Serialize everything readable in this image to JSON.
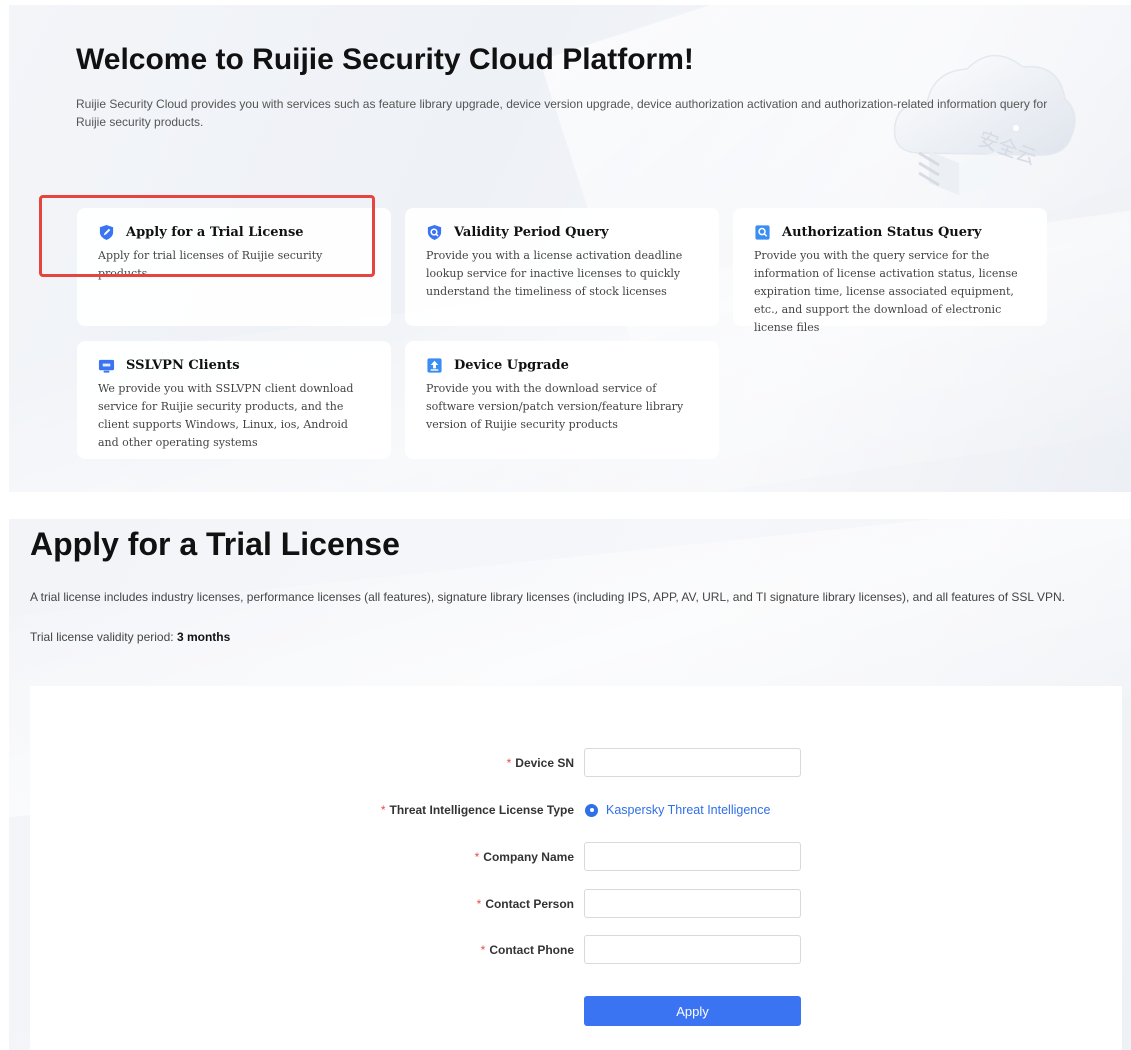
{
  "hero": {
    "title": "Welcome to Ruijie Security Cloud Platform!",
    "description": "Ruijie Security Cloud provides you with services such as feature library upgrade, device version upgrade, device authorization activation and authorization-related information query for Ruijie security products.",
    "cloud_caption": "安全云"
  },
  "cards": [
    {
      "title": "Apply for a Trial License",
      "description": "Apply for trial licenses of Ruijie security products.",
      "icon": "shield-pen-icon"
    },
    {
      "title": "Validity Period Query",
      "description": "Provide you with a license activation deadline lookup service for inactive licenses to quickly understand the timeliness of stock licenses",
      "icon": "shield-search-icon"
    },
    {
      "title": "Authorization Status Query",
      "description": "Provide you with the query service for the information of license activation status, license expiration time, license associated equipment, etc., and support the download of electronic license files",
      "icon": "document-search-icon"
    },
    {
      "title": "SSLVPN Clients",
      "description": "We provide you with SSLVPN client download service for Ruijie security products, and the client supports Windows, Linux, ios, Android and other operating systems",
      "icon": "ssl-monitor-icon"
    },
    {
      "title": "Device Upgrade",
      "description": "Provide you with the download service of software version/patch version/feature library version of Ruijie security products",
      "icon": "upgrade-arrow-icon"
    }
  ],
  "trial": {
    "title": "Apply for a Trial License",
    "description": "A trial license includes industry licenses, performance licenses (all features), signature library licenses (including IPS, APP, AV, URL, and TI signature library licenses), and all features of SSL VPN.",
    "validity_label": "Trial license validity period: ",
    "validity_value": "3 months"
  },
  "form": {
    "required_mark": "*",
    "device_sn_label": "Device SN",
    "device_sn_value": "",
    "ti_type_label": "Threat Intelligence License Type",
    "ti_type_option": "Kaspersky Threat Intelligence",
    "company_label": "Company Name",
    "company_value": "",
    "contact_person_label": "Contact Person",
    "contact_person_value": "",
    "contact_phone_label": "Contact Phone",
    "contact_phone_value": "",
    "submit_label": "Apply"
  },
  "colors": {
    "accent": "#3a74f2",
    "required": "#e34d40",
    "highlight_border": "#e6443e"
  }
}
